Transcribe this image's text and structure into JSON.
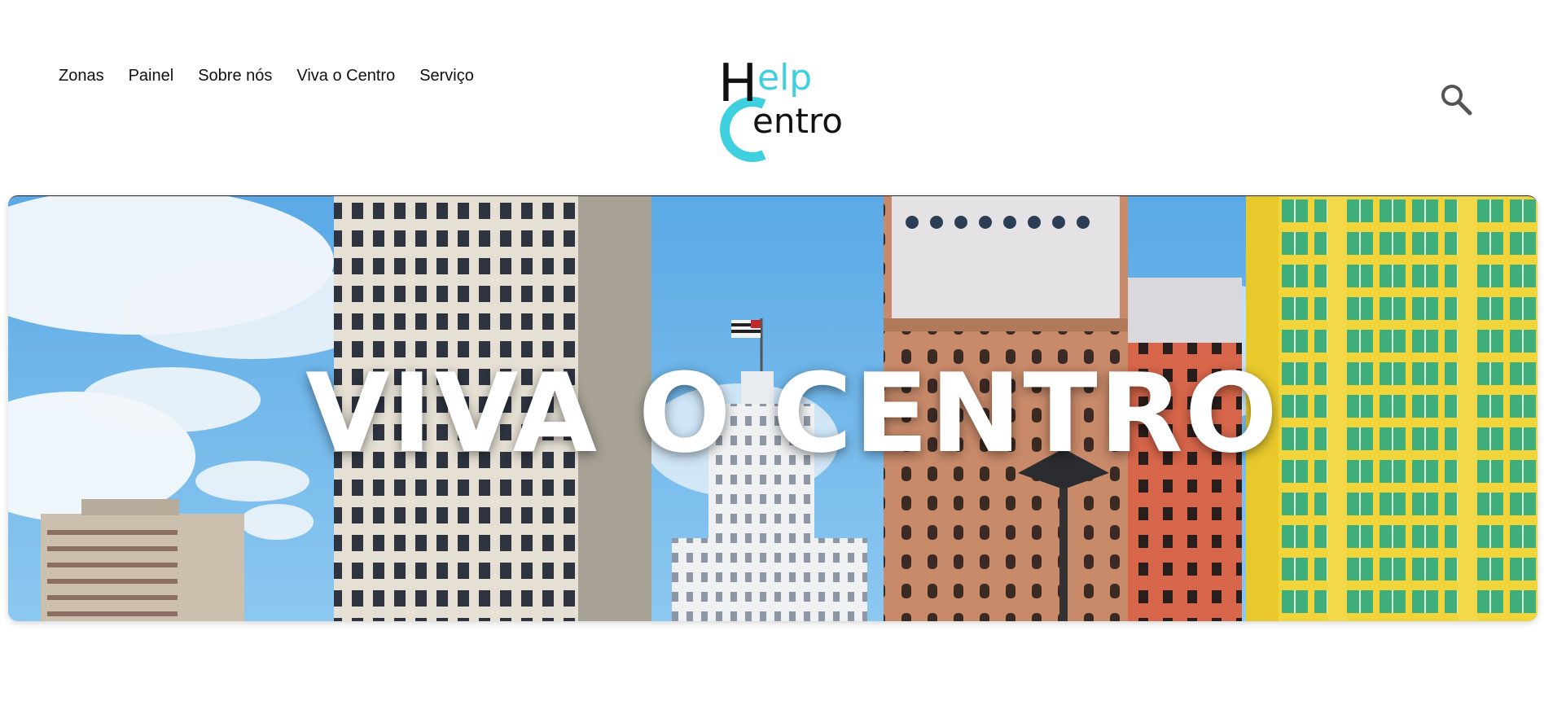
{
  "nav": {
    "items": [
      {
        "label": "Zonas"
      },
      {
        "label": "Painel"
      },
      {
        "label": "Sobre nós"
      },
      {
        "label": "Viva o Centro"
      },
      {
        "label": "Serviço"
      }
    ]
  },
  "logo": {
    "line1_initial": "H",
    "line1_rest": "elp",
    "line2_initial": "C",
    "line2_rest": "entro",
    "colors": {
      "dark": "#111111",
      "accent": "#3fd0e0"
    }
  },
  "search": {
    "icon": "search-icon"
  },
  "hero": {
    "title": "VIVA O CENTRO",
    "image": "city-center-buildings-photo"
  }
}
